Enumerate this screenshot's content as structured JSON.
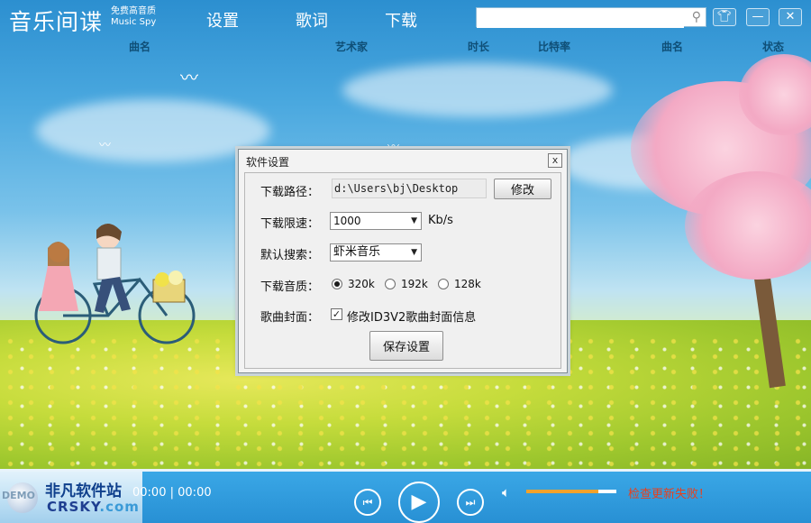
{
  "app": {
    "logo_text": "音乐间谍",
    "logo_sub_line1": "免费高音质",
    "logo_sub_line2": "Music Spy"
  },
  "nav": {
    "settings": "设置",
    "lyrics": "歌词",
    "download": "下载"
  },
  "search": {
    "value": "",
    "placeholder": ""
  },
  "columns": [
    "曲名",
    "艺术家",
    "时长",
    "比特率",
    "曲名",
    "状态"
  ],
  "dialog": {
    "title": "软件设置",
    "close_label": "x",
    "path_label": "下载路径：",
    "path_value": "d:\\Users\\bj\\Desktop",
    "path_change_button": "修改",
    "speed_label": "下载限速：",
    "speed_value": "1000",
    "speed_unit": "Kb/s",
    "search_label": "默认搜索：",
    "search_value": "虾米音乐",
    "quality_label": "下载音质：",
    "quality_options": [
      "320k",
      "192k",
      "128k"
    ],
    "quality_selected": "320k",
    "cover_label": "歌曲封面：",
    "cover_checkbox_label": "修改ID3V2歌曲封面信息",
    "cover_checked": true,
    "save_button": "保存设置"
  },
  "player": {
    "time_current": "00:00",
    "time_separator": "|",
    "time_total": "00:00",
    "volume_level": 0.8,
    "update_status": "检查更新失败！"
  },
  "watermark": {
    "line1": "非凡软件站",
    "line2_main": "CRSKY",
    "line2_suffix": ".com",
    "demo": "DEMO"
  },
  "colors": {
    "player_blue": "#2890d4",
    "volume_fill": "#f1a22b",
    "update_red": "#e8401c",
    "column_header": "#0f4f77"
  }
}
